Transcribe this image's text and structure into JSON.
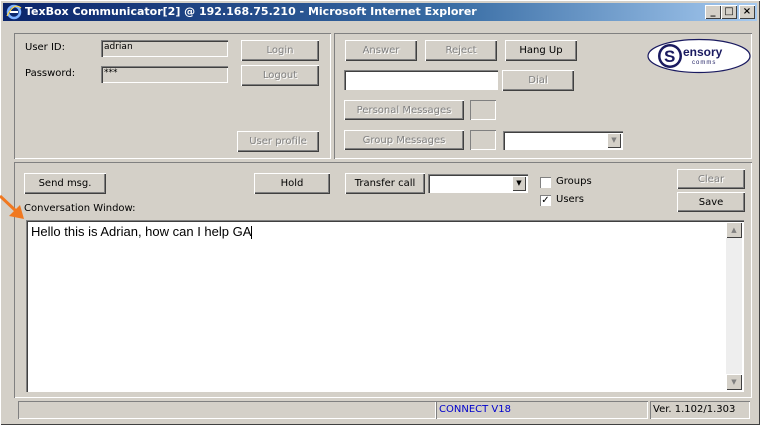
{
  "window": {
    "title": "TexBox Communicator[2] @ 192.168.75.210 - Microsoft Internet Explorer",
    "minimize": "_",
    "maximize": "□",
    "close": "×"
  },
  "login": {
    "user_id_label": "User ID:",
    "user_id_value": "adrian",
    "password_label": "Password:",
    "password_value": "***",
    "login_button": "Login",
    "logout_button": "Logout",
    "user_profile_button": "User profile"
  },
  "call": {
    "answer_button": "Answer",
    "reject_button": "Reject",
    "hangup_button": "Hang Up",
    "dial_input_value": "",
    "dial_button": "Dial",
    "personal_messages_button": "Personal Messages",
    "group_messages_button": "Group Messages",
    "group_select_value": ""
  },
  "logo": {
    "text": "ensory",
    "subtext": "comms"
  },
  "toolbar": {
    "send_button": "Send msg.",
    "hold_button": "Hold",
    "transfer_button": "Transfer call",
    "transfer_select_value": "",
    "groups_label": "Groups",
    "groups_checked": false,
    "users_label": "Users",
    "users_checked": true,
    "clear_button": "Clear",
    "save_button": "Save",
    "conversation_label": "Conversation Window:"
  },
  "conversation": {
    "text": "Hello this is Adrian, how can I help GA"
  },
  "status": {
    "left": "",
    "connection": "CONNECT V18",
    "version": "Ver. 1.102/1.303"
  },
  "colors": {
    "face": "#d4d0c8",
    "title_start": "#0a246a",
    "title_end": "#a6caf0",
    "status_blue": "#0000cc",
    "arrow": "#f07820"
  }
}
